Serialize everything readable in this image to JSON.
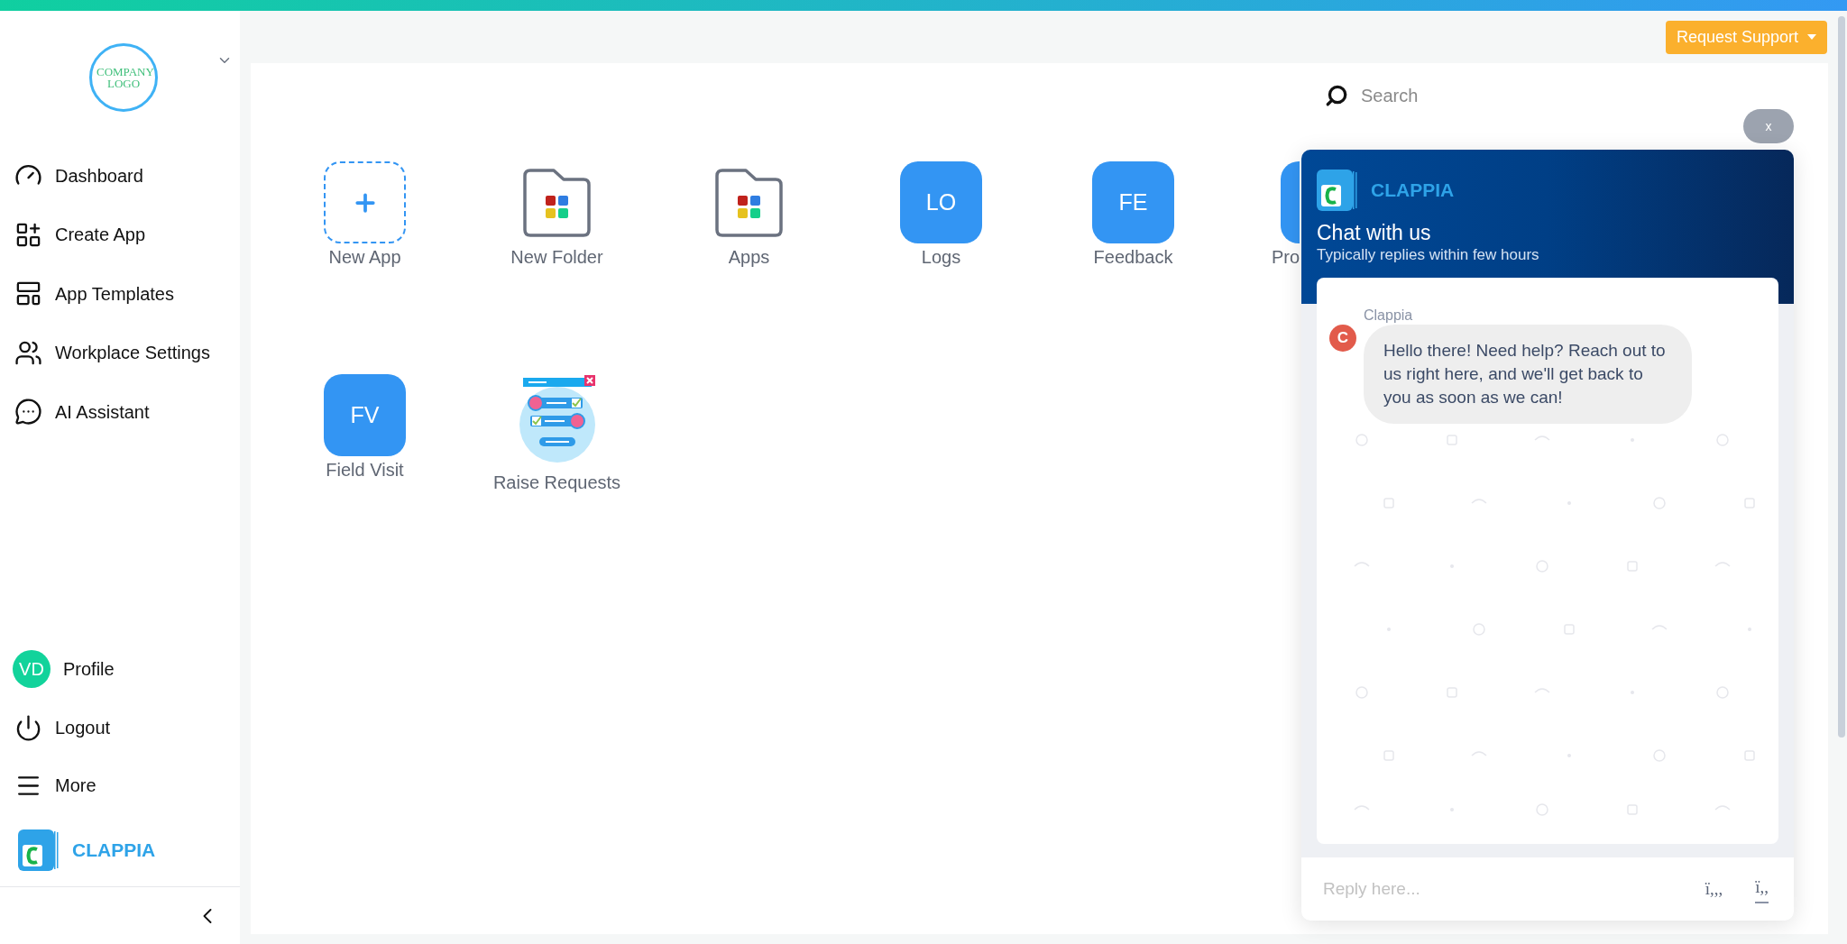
{
  "sidebar": {
    "logo_text": "COMPANY LOGO",
    "nav": [
      {
        "label": "Dashboard"
      },
      {
        "label": "Create App"
      },
      {
        "label": "App Templates"
      },
      {
        "label": "Workplace Settings"
      },
      {
        "label": "AI Assistant"
      }
    ],
    "profile": {
      "initials": "VD",
      "label": "Profile"
    },
    "bottom_items": [
      {
        "label": "Logout"
      },
      {
        "label": "More"
      }
    ],
    "brand": "CLAPPIA"
  },
  "header": {
    "support_button": "Request Support"
  },
  "search": {
    "placeholder": "Search"
  },
  "app_rows": [
    [
      {
        "kind": "add",
        "label": "New App"
      },
      {
        "kind": "folder",
        "label": "New Folder"
      },
      {
        "kind": "folder",
        "label": "Apps"
      },
      {
        "kind": "letters",
        "badge": "LO",
        "label": "Logs"
      },
      {
        "kind": "letters",
        "badge": "FE",
        "label": "Feedback"
      },
      {
        "kind": "letters_cut",
        "label": "Pro"
      }
    ],
    [
      {
        "kind": "letters",
        "badge": "FV",
        "label": "Field Visit"
      },
      {
        "kind": "picture",
        "label": "Raise Requests"
      }
    ]
  ],
  "chat": {
    "close": "x",
    "brand": "CLAPPIA",
    "title": "Chat with us",
    "subtitle": "Typically replies within few hours",
    "messages": [
      {
        "sender": "Clappia",
        "avatar": "C",
        "text": "Hello there! Need help? Reach out to us right here, and we'll get back to you as soon as we can!"
      }
    ],
    "reply": {
      "placeholder": "Reply here..."
    },
    "footer_glyphs": [
      "ï,,,",
      "ï,,"
    ]
  }
}
